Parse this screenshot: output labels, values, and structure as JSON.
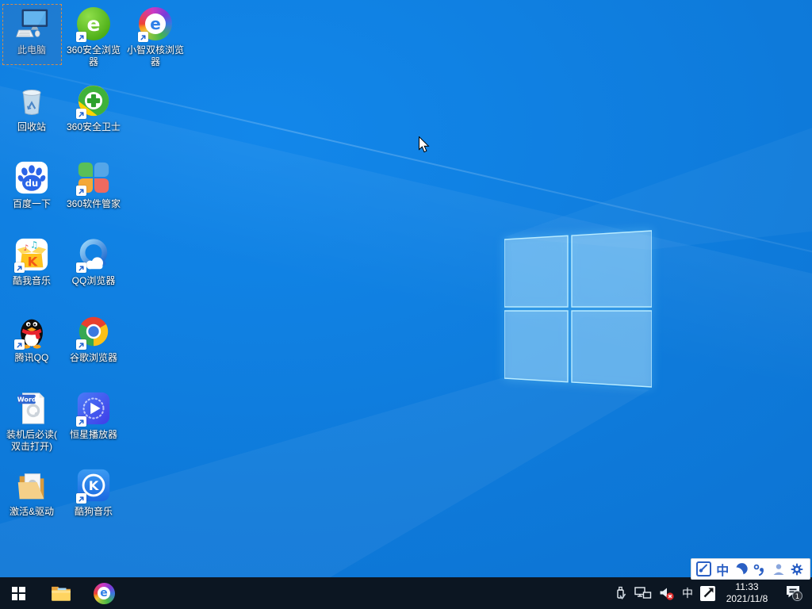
{
  "wallpaper": {
    "base_color": "#0e7ada",
    "highlight_color": "#1287ea",
    "deep_color": "#0a6ccb",
    "logo_edge_color": "#b9ecff"
  },
  "desktop": {
    "icons": [
      {
        "name": "this-pc",
        "label": "此电脑",
        "selected": true,
        "shortcut": false
      },
      {
        "name": "recycle-bin",
        "label": "回收站",
        "selected": false,
        "shortcut": false
      },
      {
        "name": "baidu-search",
        "label": "百度一下",
        "selected": false,
        "shortcut": true
      },
      {
        "name": "kuwo-music",
        "label": "酷我音乐",
        "selected": false,
        "shortcut": true
      },
      {
        "name": "tencent-qq",
        "label": "腾讯QQ",
        "selected": false,
        "shortcut": true
      },
      {
        "name": "readme-doc",
        "label": "装机后必读(\n双击打开)",
        "selected": false,
        "shortcut": false
      },
      {
        "name": "activation-drivers",
        "label": "激活&驱动",
        "selected": false,
        "shortcut": false
      },
      {
        "name": "360-secure-browser",
        "label": "360安全浏览\n器",
        "selected": false,
        "shortcut": true
      },
      {
        "name": "360-safeguard",
        "label": "360安全卫士",
        "selected": false,
        "shortcut": true
      },
      {
        "name": "360-software-manager",
        "label": "360软件管家",
        "selected": false,
        "shortcut": true
      },
      {
        "name": "qq-browser",
        "label": "QQ浏览器",
        "selected": false,
        "shortcut": true
      },
      {
        "name": "google-chrome",
        "label": "谷歌浏览器",
        "selected": false,
        "shortcut": true
      },
      {
        "name": "hengxing-player",
        "label": "恒星播放器",
        "selected": false,
        "shortcut": true
      },
      {
        "name": "kugou-music",
        "label": "酷狗音乐",
        "selected": false,
        "shortcut": true
      },
      {
        "name": "xiaozhi-dual-core-browser",
        "label": "小智双核浏览\n器",
        "selected": false,
        "shortcut": true
      }
    ]
  },
  "ime_bar": {
    "mode_text": "中",
    "icons": [
      "ime-logo",
      "chinese-english-mode",
      "full-half-width-moon",
      "punctuation",
      "skin-person",
      "settings-gear"
    ]
  },
  "taskbar": {
    "apps": [
      "start",
      "file-explorer",
      "browser-e"
    ],
    "tray": {
      "icons": [
        "usb-device",
        "network",
        "volume-muted",
        "ime-language-indicator",
        "360-tray"
      ],
      "ime_indicator": "中",
      "clock": {
        "time": "11:33",
        "date": "2021/11/8"
      },
      "notification_badge": "1"
    }
  }
}
